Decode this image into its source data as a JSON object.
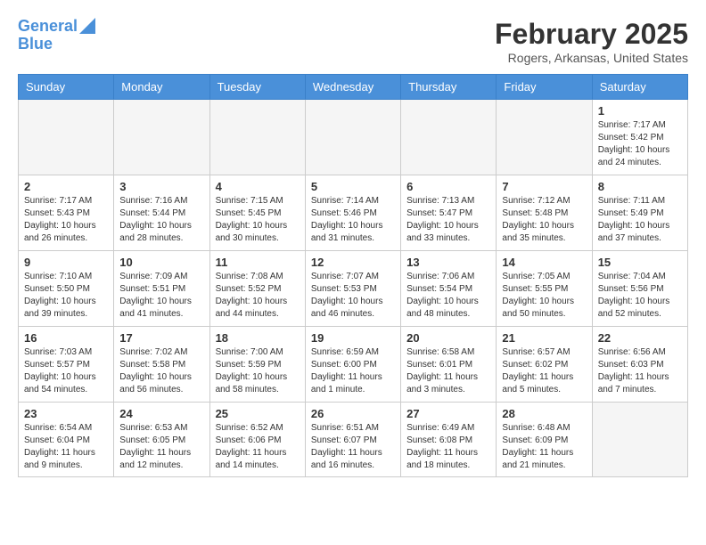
{
  "header": {
    "logo_line1": "General",
    "logo_line2": "Blue",
    "month": "February 2025",
    "location": "Rogers, Arkansas, United States"
  },
  "weekdays": [
    "Sunday",
    "Monday",
    "Tuesday",
    "Wednesday",
    "Thursday",
    "Friday",
    "Saturday"
  ],
  "weeks": [
    [
      {
        "day": "",
        "empty": true
      },
      {
        "day": "",
        "empty": true
      },
      {
        "day": "",
        "empty": true
      },
      {
        "day": "",
        "empty": true
      },
      {
        "day": "",
        "empty": true
      },
      {
        "day": "",
        "empty": true
      },
      {
        "day": "1",
        "sunrise": "7:17 AM",
        "sunset": "5:42 PM",
        "daylight": "10 hours and 24 minutes."
      }
    ],
    [
      {
        "day": "2",
        "sunrise": "7:17 AM",
        "sunset": "5:43 PM",
        "daylight": "10 hours and 26 minutes."
      },
      {
        "day": "3",
        "sunrise": "7:16 AM",
        "sunset": "5:44 PM",
        "daylight": "10 hours and 28 minutes."
      },
      {
        "day": "4",
        "sunrise": "7:15 AM",
        "sunset": "5:45 PM",
        "daylight": "10 hours and 30 minutes."
      },
      {
        "day": "5",
        "sunrise": "7:14 AM",
        "sunset": "5:46 PM",
        "daylight": "10 hours and 31 minutes."
      },
      {
        "day": "6",
        "sunrise": "7:13 AM",
        "sunset": "5:47 PM",
        "daylight": "10 hours and 33 minutes."
      },
      {
        "day": "7",
        "sunrise": "7:12 AM",
        "sunset": "5:48 PM",
        "daylight": "10 hours and 35 minutes."
      },
      {
        "day": "8",
        "sunrise": "7:11 AM",
        "sunset": "5:49 PM",
        "daylight": "10 hours and 37 minutes."
      }
    ],
    [
      {
        "day": "9",
        "sunrise": "7:10 AM",
        "sunset": "5:50 PM",
        "daylight": "10 hours and 39 minutes."
      },
      {
        "day": "10",
        "sunrise": "7:09 AM",
        "sunset": "5:51 PM",
        "daylight": "10 hours and 41 minutes."
      },
      {
        "day": "11",
        "sunrise": "7:08 AM",
        "sunset": "5:52 PM",
        "daylight": "10 hours and 44 minutes."
      },
      {
        "day": "12",
        "sunrise": "7:07 AM",
        "sunset": "5:53 PM",
        "daylight": "10 hours and 46 minutes."
      },
      {
        "day": "13",
        "sunrise": "7:06 AM",
        "sunset": "5:54 PM",
        "daylight": "10 hours and 48 minutes."
      },
      {
        "day": "14",
        "sunrise": "7:05 AM",
        "sunset": "5:55 PM",
        "daylight": "10 hours and 50 minutes."
      },
      {
        "day": "15",
        "sunrise": "7:04 AM",
        "sunset": "5:56 PM",
        "daylight": "10 hours and 52 minutes."
      }
    ],
    [
      {
        "day": "16",
        "sunrise": "7:03 AM",
        "sunset": "5:57 PM",
        "daylight": "10 hours and 54 minutes."
      },
      {
        "day": "17",
        "sunrise": "7:02 AM",
        "sunset": "5:58 PM",
        "daylight": "10 hours and 56 minutes."
      },
      {
        "day": "18",
        "sunrise": "7:00 AM",
        "sunset": "5:59 PM",
        "daylight": "10 hours and 58 minutes."
      },
      {
        "day": "19",
        "sunrise": "6:59 AM",
        "sunset": "6:00 PM",
        "daylight": "11 hours and 1 minute."
      },
      {
        "day": "20",
        "sunrise": "6:58 AM",
        "sunset": "6:01 PM",
        "daylight": "11 hours and 3 minutes."
      },
      {
        "day": "21",
        "sunrise": "6:57 AM",
        "sunset": "6:02 PM",
        "daylight": "11 hours and 5 minutes."
      },
      {
        "day": "22",
        "sunrise": "6:56 AM",
        "sunset": "6:03 PM",
        "daylight": "11 hours and 7 minutes."
      }
    ],
    [
      {
        "day": "23",
        "sunrise": "6:54 AM",
        "sunset": "6:04 PM",
        "daylight": "11 hours and 9 minutes."
      },
      {
        "day": "24",
        "sunrise": "6:53 AM",
        "sunset": "6:05 PM",
        "daylight": "11 hours and 12 minutes."
      },
      {
        "day": "25",
        "sunrise": "6:52 AM",
        "sunset": "6:06 PM",
        "daylight": "11 hours and 14 minutes."
      },
      {
        "day": "26",
        "sunrise": "6:51 AM",
        "sunset": "6:07 PM",
        "daylight": "11 hours and 16 minutes."
      },
      {
        "day": "27",
        "sunrise": "6:49 AM",
        "sunset": "6:08 PM",
        "daylight": "11 hours and 18 minutes."
      },
      {
        "day": "28",
        "sunrise": "6:48 AM",
        "sunset": "6:09 PM",
        "daylight": "11 hours and 21 minutes."
      },
      {
        "day": "",
        "empty": true
      }
    ]
  ]
}
